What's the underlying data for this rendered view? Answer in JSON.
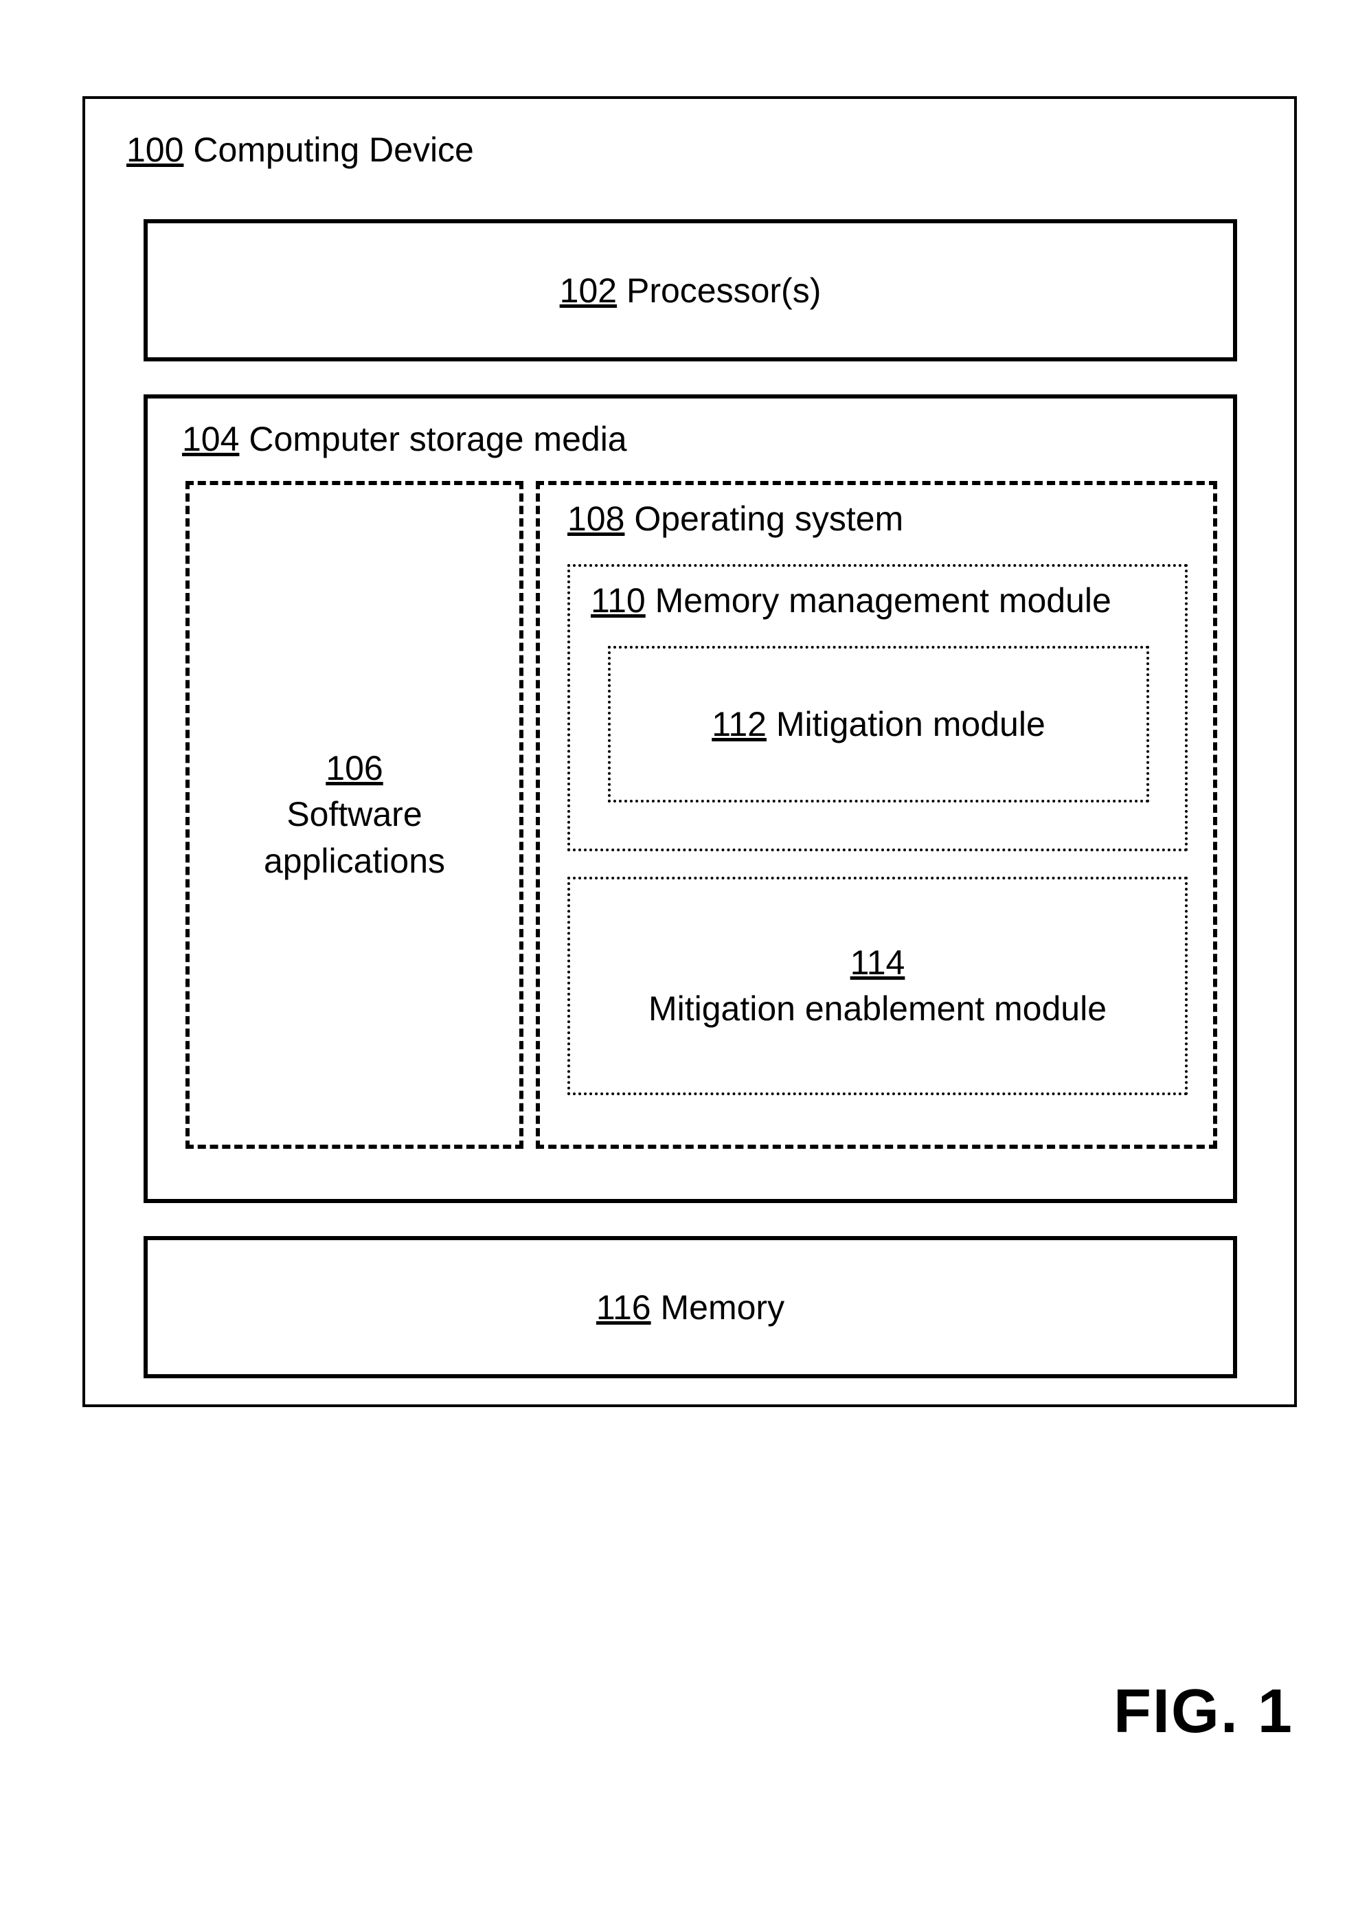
{
  "figure_label": "FIG. 1",
  "device": {
    "ref": "100",
    "label": "Computing Device"
  },
  "processors": {
    "ref": "102",
    "label": "Processor(s)"
  },
  "storage": {
    "ref": "104",
    "label": "Computer storage media"
  },
  "software": {
    "ref": "106",
    "label_line1": "Software",
    "label_line2": "applications"
  },
  "os": {
    "ref": "108",
    "label": "Operating system"
  },
  "memory_mgmt": {
    "ref": "110",
    "label": "Memory management module"
  },
  "mitigation": {
    "ref": "112",
    "label": "Mitigation module"
  },
  "mitigation_enable": {
    "ref": "114",
    "label": "Mitigation enablement module"
  },
  "memory": {
    "ref": "116",
    "label": "Memory"
  }
}
